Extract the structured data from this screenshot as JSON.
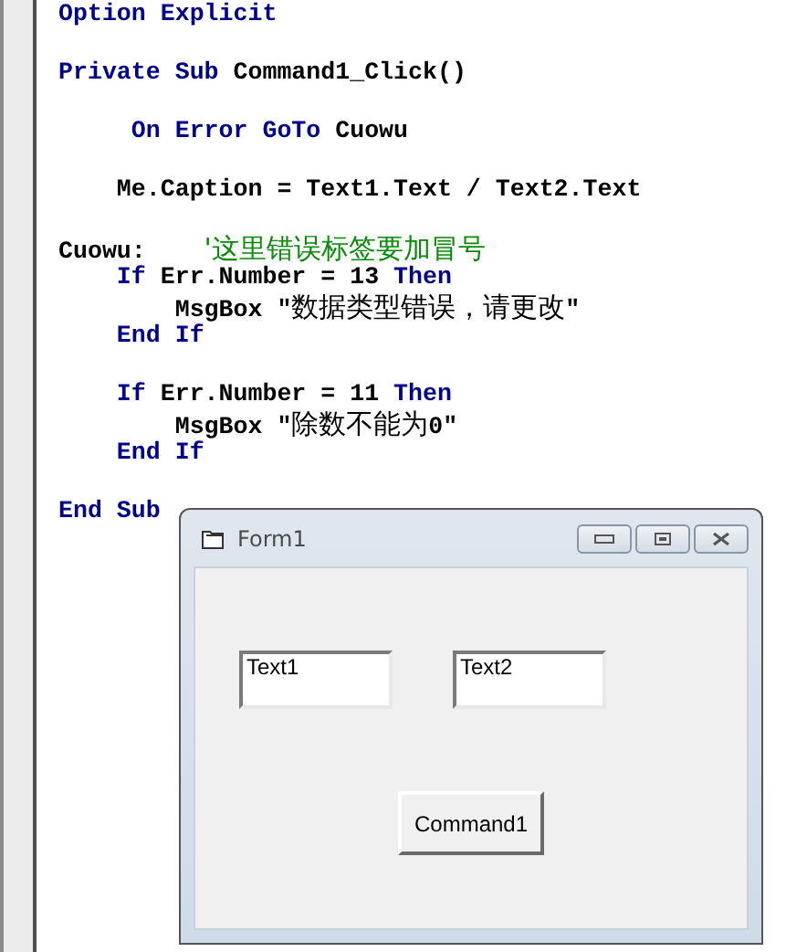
{
  "code_lines": [
    {
      "kind": "code",
      "segments": [
        {
          "kind": "keyword",
          "text": "Option Explicit"
        }
      ]
    },
    {
      "kind": "blank"
    },
    {
      "kind": "code",
      "segments": [
        {
          "kind": "keyword",
          "text": "Private Sub"
        },
        {
          "kind": "plain",
          "text": " Command1_Click()"
        }
      ]
    },
    {
      "kind": "blank"
    },
    {
      "kind": "code",
      "segments": [
        {
          "kind": "keyword",
          "text": "     On Error GoTo"
        },
        {
          "kind": "plain",
          "text": " Cuowu"
        }
      ]
    },
    {
      "kind": "blank"
    },
    {
      "kind": "code",
      "segments": [
        {
          "kind": "plain",
          "text": "    Me.Caption = Text1.Text / Text2.Text"
        }
      ]
    },
    {
      "kind": "blank"
    },
    {
      "kind": "code",
      "segments": [
        {
          "kind": "plain",
          "text": "Cuowu:    "
        },
        {
          "kind": "comment",
          "text": "'这里错误标签要加冒号"
        }
      ]
    },
    {
      "kind": "code",
      "segments": [
        {
          "kind": "keyword",
          "text": "    If"
        },
        {
          "kind": "plain",
          "text": " Err.Number = 13 "
        },
        {
          "kind": "keyword",
          "text": "Then"
        }
      ]
    },
    {
      "kind": "code",
      "segments": [
        {
          "kind": "plain",
          "text": "        MsgBox \""
        },
        {
          "kind": "cjk",
          "text": "数据类型错误，请更改"
        },
        {
          "kind": "plain",
          "text": "\""
        }
      ]
    },
    {
      "kind": "code",
      "segments": [
        {
          "kind": "keyword",
          "text": "    End If"
        }
      ]
    },
    {
      "kind": "blank"
    },
    {
      "kind": "code",
      "segments": [
        {
          "kind": "keyword",
          "text": "    If"
        },
        {
          "kind": "plain",
          "text": " Err.Number = 11 "
        },
        {
          "kind": "keyword",
          "text": "Then"
        }
      ]
    },
    {
      "kind": "code",
      "segments": [
        {
          "kind": "plain",
          "text": "        MsgBox \""
        },
        {
          "kind": "cjk",
          "text": "除数不能为"
        },
        {
          "kind": "plain",
          "text": "0\""
        }
      ]
    },
    {
      "kind": "code",
      "segments": [
        {
          "kind": "keyword",
          "text": "    End If"
        }
      ]
    },
    {
      "kind": "blank"
    },
    {
      "kind": "code",
      "segments": [
        {
          "kind": "keyword",
          "text": "End Sub"
        }
      ]
    }
  ],
  "form": {
    "title": "Form1",
    "textboxes": [
      "Text1",
      "Text2"
    ],
    "button": "Command1"
  }
}
